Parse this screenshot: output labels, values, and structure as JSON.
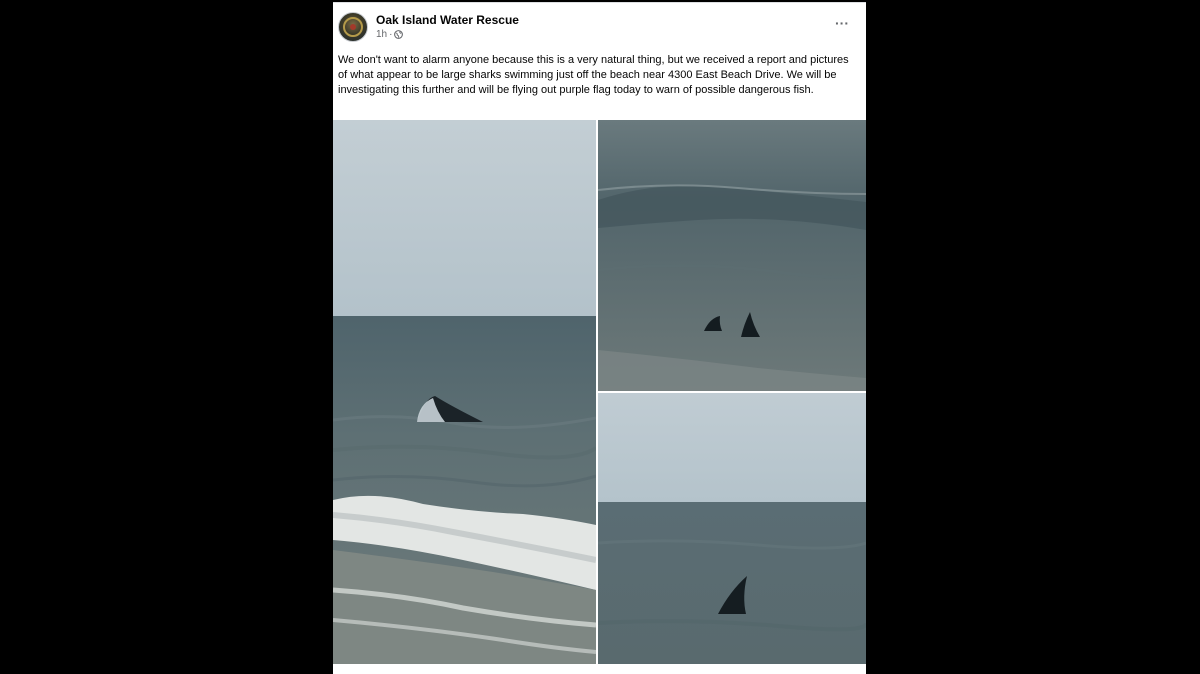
{
  "post": {
    "page_name": "Oak Island Water Rescue",
    "timestamp": "1h",
    "separator": "·",
    "privacy_icon": "globe-icon",
    "more_icon": "more-options-icon",
    "more_label": "···",
    "text": "We don't want to alarm anyone because this is a very natural thing, but we received a report and pictures of what appear to be large sharks swimming just off the beach near 4300 East Beach Drive. We will be investigating this further and will be flying out purple flag today to warn of possible dangerous fish."
  },
  "photos": [
    {
      "name": "shark-fin-near-shore-photo"
    },
    {
      "name": "two-shark-fins-photo"
    },
    {
      "name": "single-shark-fin-photo"
    }
  ],
  "colors": {
    "background": "#000000",
    "card": "#ffffff",
    "primary_text": "#050505",
    "secondary_text": "#65676b",
    "sky": "#b9c7cf",
    "sea": "#5a6c72"
  }
}
